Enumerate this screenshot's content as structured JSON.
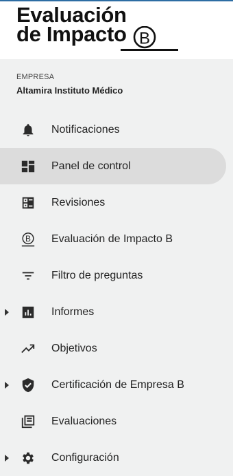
{
  "logo": {
    "line1": "Evaluación",
    "line2": "de Impacto",
    "b_mark": "B"
  },
  "org": {
    "label": "EMPRESA",
    "name": "Altamira Instituto Médico"
  },
  "nav": {
    "items": [
      {
        "label": "Notificaciones",
        "icon": "bell-icon"
      },
      {
        "label": "Panel de control",
        "icon": "dashboard-icon",
        "active": true
      },
      {
        "label": "Revisiones",
        "icon": "reviews-icon"
      },
      {
        "label": "Evaluación de Impacto B",
        "icon": "b-corp-icon"
      },
      {
        "label": "Filtro de preguntas",
        "icon": "filter-icon"
      },
      {
        "label": "Informes",
        "icon": "bar-chart-icon",
        "expandable": true
      },
      {
        "label": "Objetivos",
        "icon": "trending-up-icon"
      },
      {
        "label": "Certificación de Empresa B",
        "icon": "verified-shield-icon",
        "expandable": true
      },
      {
        "label": "Evaluaciones",
        "icon": "library-books-icon"
      },
      {
        "label": "Configuración",
        "icon": "gear-icon",
        "expandable": true
      }
    ]
  },
  "colors": {
    "sidebar_bg": "#f0f1f1",
    "active_bg": "#dcdcdc",
    "icon": "#2b2b2b",
    "top_line": "#2d6da3"
  }
}
